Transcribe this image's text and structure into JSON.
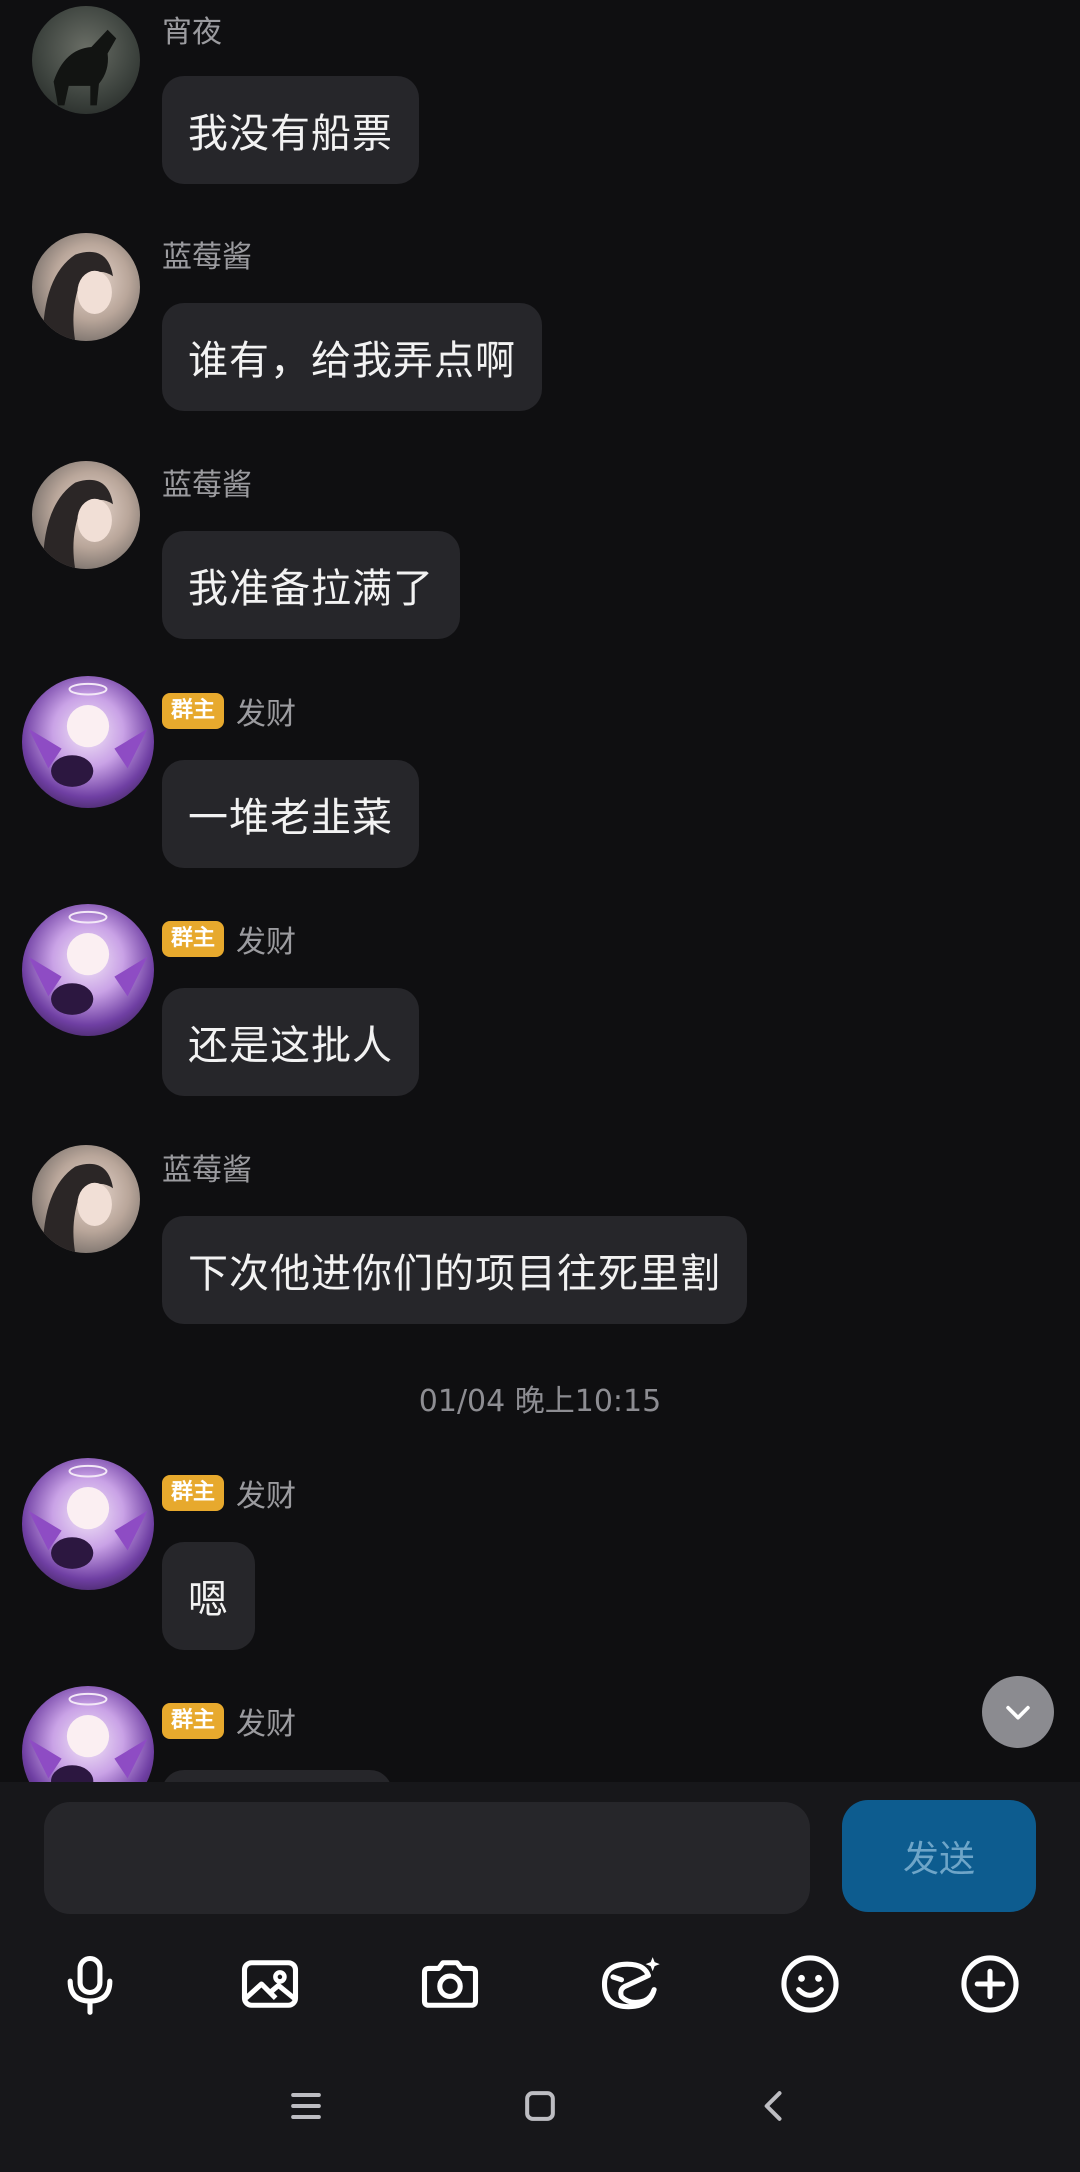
{
  "messages": [
    {
      "sender": "宵夜",
      "owner": false,
      "text": "我没有船票",
      "avatar": "horse-photo"
    },
    {
      "sender": "蓝莓酱",
      "owner": false,
      "text": "谁有，给我弄点啊",
      "avatar": "girl-photo"
    },
    {
      "sender": "蓝莓酱",
      "owner": false,
      "text": "我准备拉满了",
      "avatar": "girl-photo"
    },
    {
      "sender": "发财",
      "owner": true,
      "text": "一堆老韭菜",
      "avatar": "angel-doll"
    },
    {
      "sender": "发财",
      "owner": true,
      "text": "还是这批人",
      "avatar": "angel-doll"
    },
    {
      "sender": "蓝莓酱",
      "owner": false,
      "text": "下次他进你们的项目往死里割",
      "avatar": "girl-photo"
    },
    {
      "sender": "发财",
      "owner": true,
      "text": "嗯",
      "avatar": "angel-doll"
    },
    {
      "sender": "发财",
      "owner": true,
      "text": "",
      "avatar": "angel-doll"
    }
  ],
  "owner_badge": "群主",
  "timestamp": "01/04 晚上10:15",
  "input": {
    "value": "",
    "placeholder": ""
  },
  "send_label": "发送",
  "toolbar": [
    "microphone-icon",
    "image-icon",
    "camera-icon",
    "emoji-sticker-icon",
    "smiley-icon",
    "plus-icon"
  ],
  "colors": {
    "background": "#0f0f11",
    "bubble": "#26262a",
    "badge": "#e7a92d",
    "send": "#0d5c8f"
  }
}
